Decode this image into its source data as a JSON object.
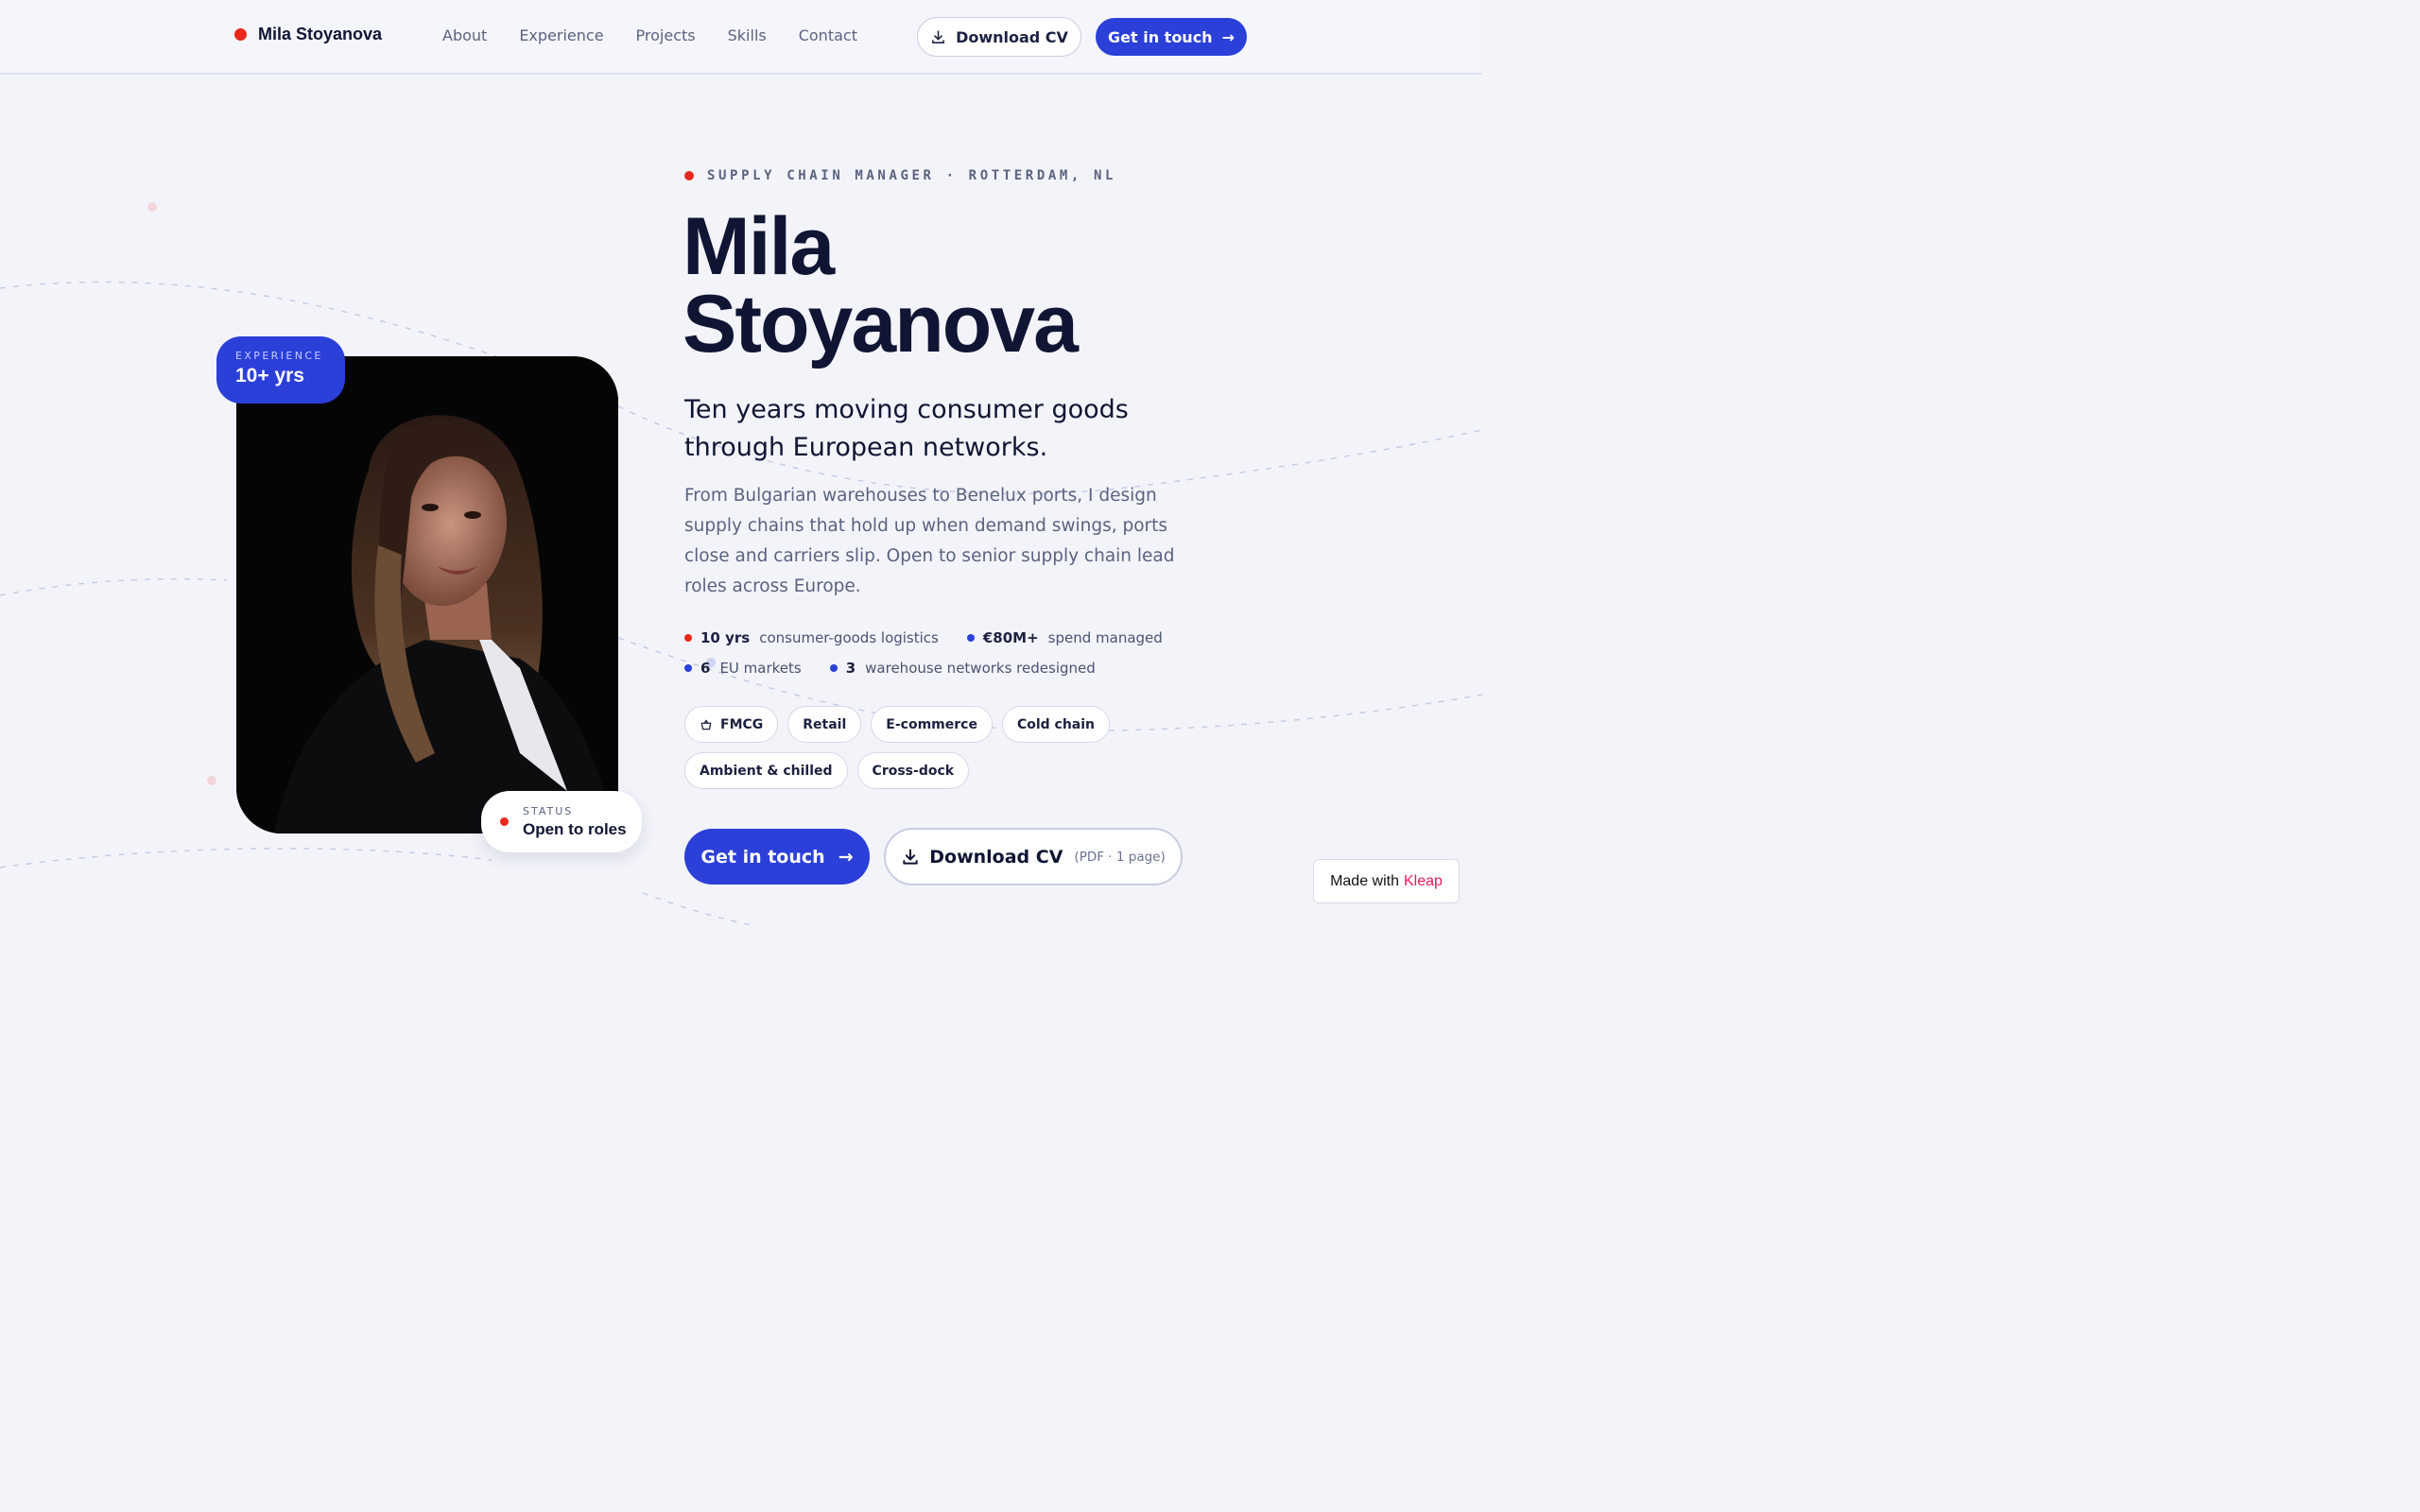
{
  "nav": {
    "brand": "Mila Stoyanova",
    "links": [
      "About",
      "Experience",
      "Projects",
      "Skills",
      "Contact"
    ],
    "download_cv": "Download CV",
    "get_in_touch": "Get in touch",
    "arrow": "→"
  },
  "hero": {
    "eyebrow": "SUPPLY CHAIN MANAGER · ROTTERDAM, NL",
    "name_line1": "Mila",
    "name_line2": "Stoyanova",
    "tagline": "Ten years moving consumer goods through European networks.",
    "bio": "From Bulgarian warehouses to Benelux ports, I design supply chains that hold up when demand swings, ports close and carriers slip. Open to senior supply chain lead roles across Europe.",
    "stats": [
      {
        "value": "10 yrs",
        "label": "consumer-goods logistics",
        "color": "#e8281c"
      },
      {
        "value": "€80M+",
        "label": "spend managed",
        "color": "#2b3fd9"
      },
      {
        "value": "6",
        "label": "EU markets",
        "color": "#2b3fd9"
      },
      {
        "value": "3",
        "label": "warehouse networks redesigned",
        "color": "#2b3fd9"
      }
    ],
    "chips": [
      "FMCG",
      "Retail",
      "E-commerce",
      "Cold chain",
      "Ambient & chilled",
      "Cross-dock"
    ],
    "cta_primary": "Get in touch",
    "cta_secondary": "Download CV",
    "cta_secondary_meta": "(PDF · 1 page)"
  },
  "photo": {
    "experience_label": "EXPERIENCE",
    "experience_value": "10+ yrs",
    "status_label": "STATUS",
    "status_value": "Open to roles"
  },
  "footer_badge": {
    "prefix": "Made with",
    "brand": "Kleap"
  },
  "colors": {
    "accent": "#2b3fd9",
    "dot_red": "#e8281c",
    "background": "#f3f4fa",
    "kleap": "#e8195e"
  }
}
